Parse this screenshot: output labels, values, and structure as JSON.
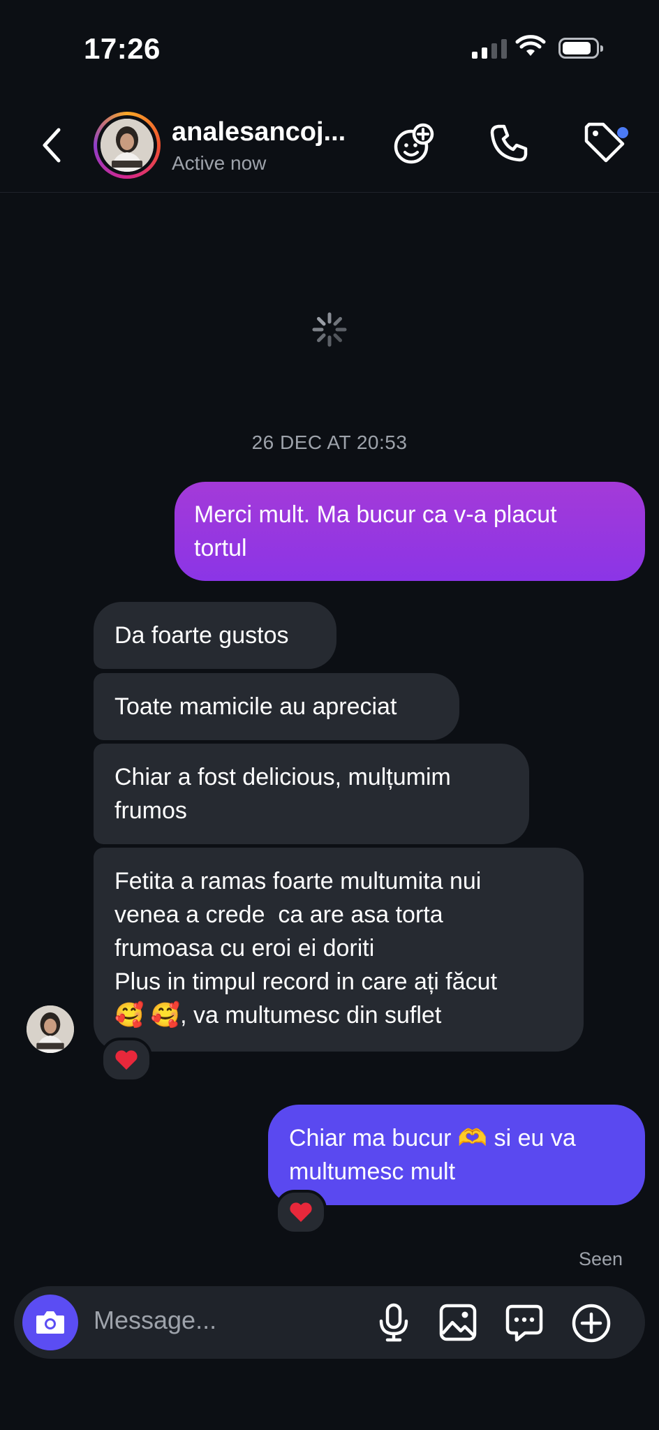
{
  "status_bar": {
    "time": "17:26"
  },
  "header": {
    "username": "analesancoj...",
    "status": "Active now"
  },
  "conversation": {
    "date_label": "26 DEC AT 20:53",
    "messages": [
      {
        "from": "me",
        "text": "Merci mult. Ma bucur ca v-a placut\ntortul"
      },
      {
        "from": "them",
        "text": "Da foarte gustos"
      },
      {
        "from": "them",
        "text": "Toate mamicile au apreciat"
      },
      {
        "from": "them",
        "text": "Chiar a fost delicious, mulțumim\nfrumos"
      },
      {
        "from": "them",
        "text": "Fetita a ramas foarte multumita nui\nvenea a crede  ca are asa torta\nfrumoasa cu eroi ei doriti\nPlus in timpul record in care ați făcut\n🥰 🥰, va multumesc din suflet",
        "reaction": "❤️"
      },
      {
        "from": "me",
        "text": "Chiar ma bucur 🫶 si eu va\nmultumesc mult",
        "reaction": "❤️"
      }
    ],
    "seen_label": "Seen"
  },
  "composer": {
    "placeholder": "Message..."
  },
  "colors": {
    "background": "#0c0f14",
    "incoming_bubble": "#262a31",
    "outgoing_bubble_1": "#9a37df",
    "outgoing_bubble_2": "#5a49f0",
    "accent_dot": "#4c7bf5"
  },
  "icons": [
    "back-chevron-icon",
    "avatar",
    "sticker-add-icon",
    "phone-icon",
    "tag-icon",
    "loading-spinner-icon",
    "camera-icon",
    "microphone-icon",
    "gallery-icon",
    "chat-bubble-icon",
    "plus-circle-icon",
    "heart-icon"
  ]
}
